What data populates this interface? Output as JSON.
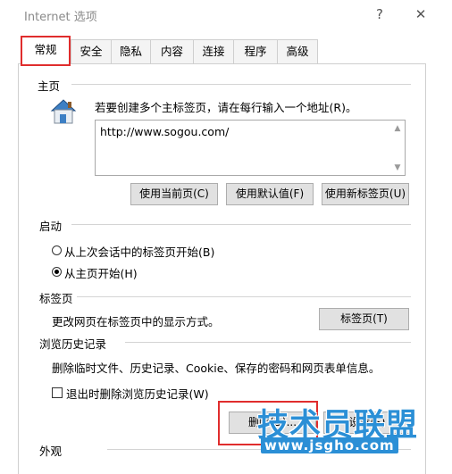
{
  "window": {
    "title": "Internet 选项",
    "help_glyph": "?",
    "close_glyph": "✕"
  },
  "tabs": [
    {
      "label": "常规",
      "active": true
    },
    {
      "label": "安全"
    },
    {
      "label": "隐私"
    },
    {
      "label": "内容"
    },
    {
      "label": "连接"
    },
    {
      "label": "程序"
    },
    {
      "label": "高级"
    }
  ],
  "homepage": {
    "section_title": "主页",
    "description": "若要创建多个主标签页，请在每行输入一个地址(R)。",
    "url_value": "http://www.sogou.com/",
    "buttons": {
      "use_current": "使用当前页(C)",
      "use_default": "使用默认值(F)",
      "use_new_tab": "使用新标签页(U)"
    }
  },
  "startup": {
    "section_title": "启动",
    "options": [
      {
        "label": "从上次会话中的标签页开始(B)",
        "checked": false
      },
      {
        "label": "从主页开始(H)",
        "checked": true
      }
    ]
  },
  "tabs_section": {
    "section_title": "标签页",
    "description": "更改网页在标签页中的显示方式。",
    "button": "标签页(T)"
  },
  "history": {
    "section_title": "浏览历史记录",
    "description": "删除临时文件、历史记录、Cookie、保存的密码和网页表单信息。",
    "checkbox_label": "退出时删除浏览历史记录(W)",
    "checkbox_checked": false,
    "delete_button_partial": "删除(D)...",
    "settings_button_partial": "设置(S)"
  },
  "appearance": {
    "section_title": "外观"
  },
  "watermark": {
    "brand": "技术员联盟",
    "url": "www.jsgho.com"
  },
  "colors": {
    "highlight_red": "#e02d2d",
    "watermark_blue": "#2b8fd6"
  }
}
